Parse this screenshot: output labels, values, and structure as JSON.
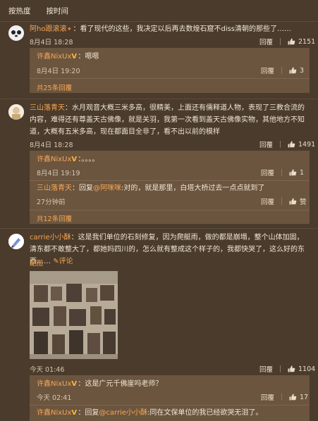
{
  "sort": {
    "hot": "按热度",
    "time": "按时间"
  },
  "comments": [
    {
      "user": "阿ho跟滚滚",
      "text": "：看了现代的这些，我决定以后再去数煌石窟不diss清朝的那些了……",
      "time": "8月4日 18:28",
      "reply": "回覆",
      "likes": "2151",
      "replies": [
        {
          "user": "许鑫NixUx",
          "text": "：嗯嗯",
          "time": "8月4日 19:20",
          "reply": "回覆",
          "likes": "3"
        }
      ],
      "more": "共25条回覆"
    },
    {
      "user": "三山落青天",
      "text": "：水月观音大概三米多高，很精美，上面还有儒释道人物，表现了三教合流的内容，难得还有尊盖天古佛像，就是关羽，我第一次看到盖天古佛像实物，其他地方不知道，大概有五米多高，现在都面目全非了，看不出以前的模样",
      "time": "8月4日 18:28",
      "reply": "回覆",
      "likes": "1491",
      "replies": [
        {
          "user": "许鑫NixUx",
          "text": "：。。。。",
          "time": "8月4日 19:19",
          "reply": "回覆",
          "likes": "1"
        },
        {
          "user": "三山落青天",
          "text_prefix": "：回复",
          "mention": "@阿咪咪",
          "text": ":对的，就是那里，白塔大桥过去一点点就到了",
          "time": "27分钟前",
          "reply": "回覆",
          "likes": "赞"
        }
      ],
      "more": "共12条回覆"
    },
    {
      "user": "carrie小小酥",
      "text": "：这是我们单位的石刻修复，因为爬艇雨，做的都是崩塌，整个山体加固，清东都不敢整大了，都她妈四川的，怎么就有整成这个样子的，我都快哭了，这么好的东西……",
      "comment_label": "评论",
      "photo_label": "配图",
      "time": "今天 01:46",
      "reply": "回覆",
      "likes": "1104",
      "replies": [
        {
          "user": "许鑫NixUx",
          "text": "：这是广元千佛崖吗老师？",
          "time": "今天 02:41",
          "reply": "回覆",
          "likes": "17"
        },
        {
          "user": "许鑫NixUx",
          "text_prefix": "：回复",
          "mention": "@carrie小小酥",
          "text": ":同在文保单位的我已经欲哭无泪了。"
        }
      ]
    }
  ],
  "colors": {
    "background": "#4a3b2c",
    "reply_bg": "#6b553f",
    "accent": "#f7a653"
  }
}
